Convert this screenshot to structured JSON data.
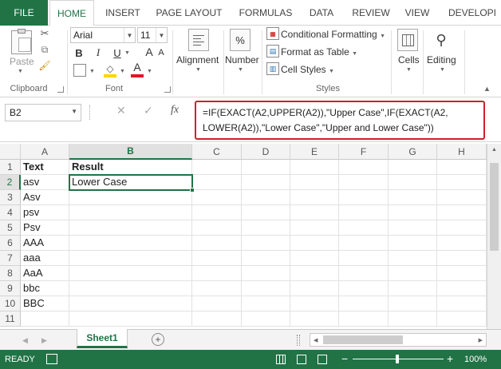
{
  "tabs": {
    "file": "FILE",
    "items": [
      "HOME",
      "INSERT",
      "PAGE LAYOUT",
      "FORMULAS",
      "DATA",
      "REVIEW",
      "VIEW",
      "DEVELOPI"
    ],
    "active": "HOME"
  },
  "ribbon": {
    "clipboard": {
      "paste": "Paste",
      "label": "Clipboard"
    },
    "font": {
      "name": "Arial",
      "size": "11",
      "bold": "B",
      "italic": "I",
      "underline": "U",
      "grow": "A",
      "shrink": "A",
      "font_color": "A",
      "label": "Font"
    },
    "alignment": {
      "label": "Alignment"
    },
    "number": {
      "label": "Number",
      "symbol": "%"
    },
    "styles": {
      "conditional": "Conditional Formatting",
      "format_table": "Format as Table",
      "cell_styles": "Cell Styles",
      "label": "Styles"
    },
    "cells": {
      "label": "Cells"
    },
    "editing": {
      "label": "Editing"
    }
  },
  "formula_bar": {
    "name_box": "B2",
    "cancel": "✕",
    "enter": "✓",
    "fx": "fx",
    "line1": "=IF(EXACT(A2,UPPER(A2)),\"Upper Case\",IF(EXACT(A2,",
    "line2": "LOWER(A2)),\"Lower Case\",\"Upper and Lower Case\"))"
  },
  "grid": {
    "columns": [
      "A",
      "B",
      "C",
      "D",
      "E",
      "F",
      "G",
      "H"
    ],
    "active_column": "B",
    "rows": [
      "1",
      "2",
      "3",
      "4",
      "5",
      "6",
      "7",
      "8",
      "9",
      "10",
      "11"
    ],
    "active_row": "2",
    "colA": [
      "Text",
      "asv",
      "Asv",
      "psv",
      "Psv",
      "AAA",
      "aaa",
      "AaA",
      "bbc",
      "BBC",
      ""
    ],
    "colB": [
      "Result",
      "Lower Case",
      "",
      "",
      "",
      "",
      "",
      "",
      "",
      "",
      ""
    ]
  },
  "sheets": {
    "active": "Sheet1",
    "add": "+"
  },
  "status": {
    "ready": "READY",
    "zoom_minus": "−",
    "zoom_plus": "+",
    "zoom": "100%"
  },
  "colors": {
    "accent": "#217346",
    "highlight": "#d0202a",
    "font_color_bar": "#e81123",
    "fill_color_bar": "#ffd500"
  }
}
